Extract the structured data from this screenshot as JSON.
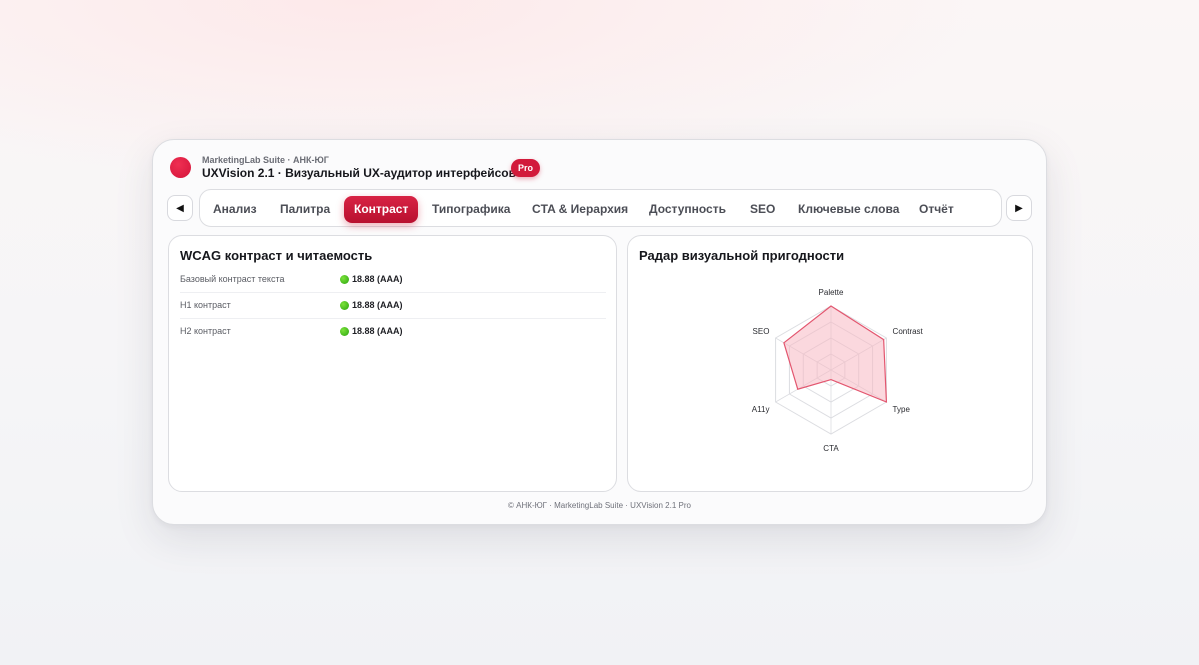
{
  "header": {
    "suite": "MarketingLab Suite · АНК-ЮГ",
    "title": "UXVision 2.1 · Визуальный UX-аудитор интерфейсов",
    "badge": "Pro"
  },
  "nav": {
    "prev_icon": "◀",
    "next_icon": "▶",
    "tabs": [
      {
        "label": "Анализ"
      },
      {
        "label": "Палитра"
      },
      {
        "label": "Контраст",
        "active": true
      },
      {
        "label": "Типографика"
      },
      {
        "label": "CTA & Иерархия"
      },
      {
        "label": "Доступность"
      },
      {
        "label": "SEO"
      },
      {
        "label": "Ключевые слова"
      },
      {
        "label": "Отчёт"
      }
    ]
  },
  "contrast_panel": {
    "title": "WCAG контраст и читаемость",
    "rows": [
      {
        "label": "Базовый контраст текста",
        "value": "18.88 (AAA)",
        "status": "ok"
      },
      {
        "label": "H1 контраст",
        "value": "18.88 (AAA)",
        "status": "ok"
      },
      {
        "label": "H2 контраст",
        "value": "18.88 (AAA)",
        "status": "ok"
      }
    ]
  },
  "radar_panel": {
    "title": "Радар визуальной пригодности"
  },
  "chart_data": {
    "type": "radar",
    "axes": [
      "Palette",
      "Contrast",
      "Type",
      "CTA",
      "A11y",
      "SEO"
    ],
    "values": [
      100,
      95,
      100,
      15,
      60,
      85
    ],
    "range": [
      0,
      100
    ],
    "rings": 4,
    "colors": {
      "fill": "#f7b8c3",
      "stroke": "#e3566f",
      "grid": "#dcdde1"
    }
  },
  "footer": {
    "text": "© АНК-ЮГ · MarketingLab Suite · UXVision 2.1 Pro"
  },
  "colors": {
    "accent": "#d21a3b",
    "ok": "#2aa40f"
  }
}
